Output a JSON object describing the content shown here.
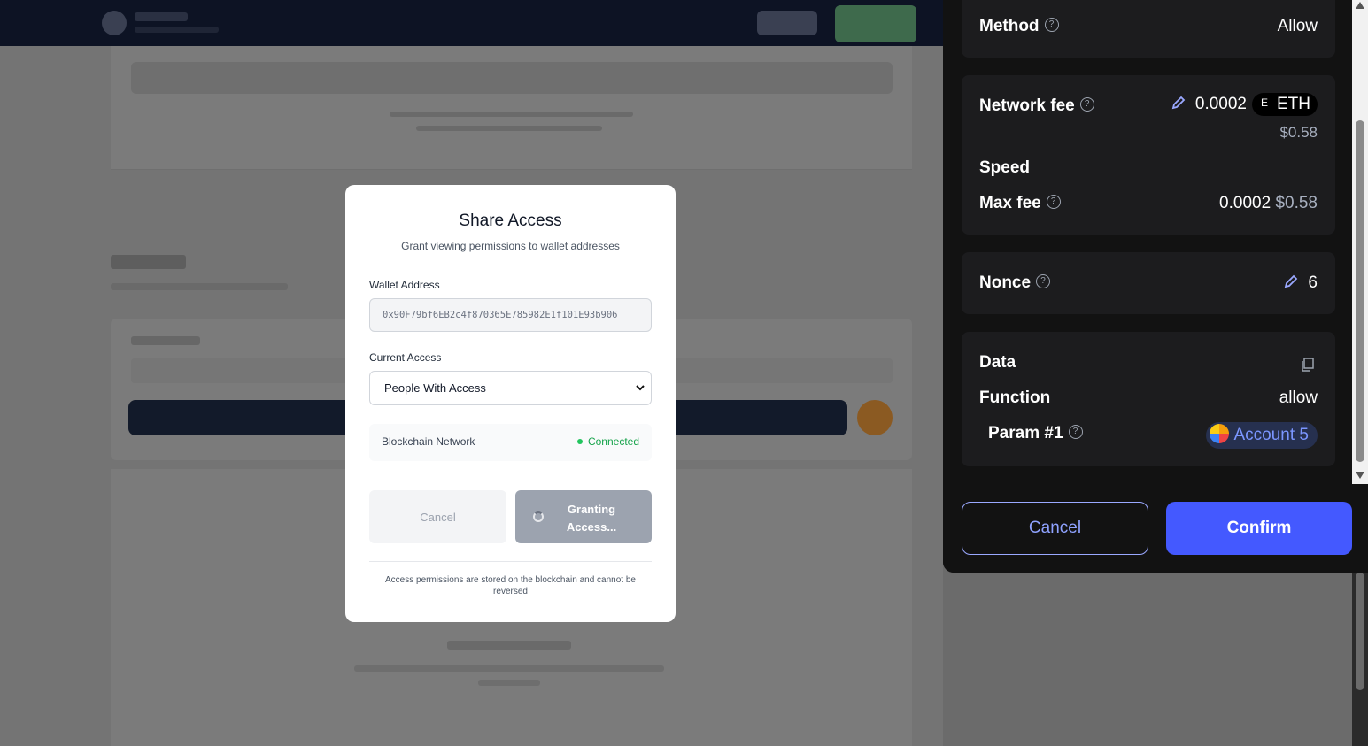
{
  "modal": {
    "title": "Share Access",
    "subtitle": "Grant viewing permissions to wallet addresses",
    "wallet_label": "Wallet Address",
    "wallet_value": "0x90F79bf6EB2c4f870365E785982E1f101E93b906",
    "access_label": "Current Access",
    "access_selected": "People With Access",
    "network_label": "Blockchain Network",
    "network_status": "Connected",
    "cancel_label": "Cancel",
    "grant_label": "Granting Access...",
    "footnote": "Access permissions are stored on the blockchain and cannot be reversed"
  },
  "wallet": {
    "method_label": "Method",
    "method_value": "Allow",
    "network_fee_label": "Network fee",
    "network_fee_value": "0.0002",
    "eth_symbol_letter": "E",
    "eth_symbol": "ETH",
    "network_fee_usd": "$0.58",
    "speed_label": "Speed",
    "max_fee_label": "Max fee",
    "max_fee_value": "0.0002",
    "max_fee_usd": "$0.58",
    "nonce_label": "Nonce",
    "nonce_value": "6",
    "data_label": "Data",
    "function_label": "Function",
    "function_value": "allow",
    "param_label": "Param #1",
    "param_value": "Account 5",
    "cancel_label": "Cancel",
    "confirm_label": "Confirm"
  },
  "colors": {
    "confirm_bg": "#4459ff",
    "connected": "#16a34a",
    "panel_bg": "#121212",
    "card_bg": "#1c1c1e"
  },
  "icons": {
    "help": "help-circle-icon",
    "edit": "pencil-icon",
    "copy": "copy-icon",
    "spinner": "spinner-icon",
    "dropdown": "chevron-down-icon"
  }
}
